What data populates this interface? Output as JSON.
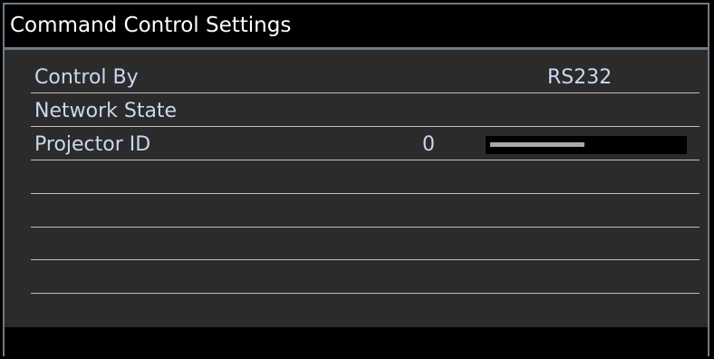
{
  "title": "Command Control Settings",
  "items": [
    {
      "label": "Control By",
      "value": "RS232"
    },
    {
      "label": "Network State",
      "value": ""
    },
    {
      "label": "Projector ID",
      "value": "0"
    }
  ],
  "projector_id_slider": {
    "fraction": 0.49
  },
  "colors": {
    "panel_bg": "#2b2b2b",
    "bar_bg": "#000000",
    "border": "#6f7a86",
    "label_text": "#c9d8f0",
    "title_text": "#ffffff",
    "divider": "#bfbfbf",
    "slider_fill": "#a9a9a9"
  }
}
